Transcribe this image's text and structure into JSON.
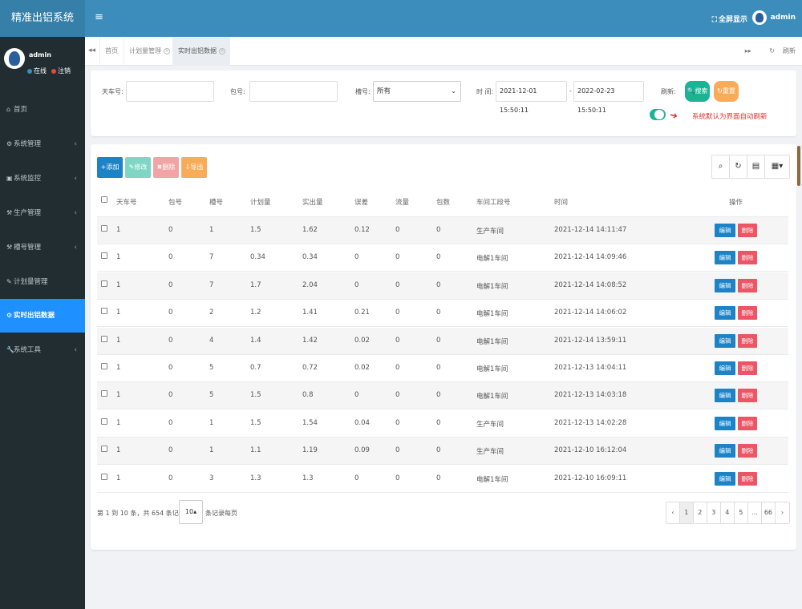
{
  "app": {
    "title": "精准出铝系统",
    "menu_icon": "≡"
  },
  "topbar": {
    "fullscreen": "全屏显示",
    "user": "admin"
  },
  "sidebar": {
    "user": {
      "name": "admin",
      "status_online": "在线",
      "logout": "注销"
    },
    "items": [
      {
        "label": "首页",
        "icon": "home-icon"
      },
      {
        "label": "系统管理",
        "icon": "gear-icon"
      },
      {
        "label": "系统监控",
        "icon": "monitor-icon"
      },
      {
        "label": "生产管理",
        "icon": "tools-icon"
      },
      {
        "label": "槽号管理",
        "icon": "tools-icon"
      },
      {
        "label": "计划量管理",
        "icon": "edit-icon"
      },
      {
        "label": "实时出铝数据",
        "icon": "gear-icon",
        "active": true
      },
      {
        "label": "系统工具",
        "icon": "wrench-icon"
      }
    ]
  },
  "tabs": {
    "items": [
      "首页",
      "计划量管理",
      "实时出铝数据"
    ],
    "refresh": "刷新"
  },
  "search": {
    "car_label": "天车号:",
    "bag_label": "包号:",
    "slot_label": "槽号:",
    "slot_value": "所有",
    "time_label": "时 间:",
    "time_start": "2021-12-01 15:50:11",
    "time_sep": "-",
    "time_end": "2022-02-23 15:50:11",
    "refresh_label": "刷新:",
    "search_btn": "搜索",
    "reset_btn": "重置",
    "hint": "系统默认为界面自动刷新"
  },
  "toolbar": {
    "add": "添加",
    "edit": "修改",
    "delete": "删除",
    "export": "导出"
  },
  "table": {
    "headers": [
      "天车号",
      "包号",
      "槽号",
      "计划量",
      "实出量",
      "误差",
      "流量",
      "包数",
      "车间工段号",
      "时间",
      "操作"
    ],
    "rows": [
      [
        "1",
        "0",
        "1",
        "1.5",
        "1.62",
        "0.12",
        "0",
        "0",
        "生产车间",
        "2021-12-14 14:11:47"
      ],
      [
        "1",
        "0",
        "7",
        "0.34",
        "0.34",
        "0",
        "0",
        "0",
        "电解1车间",
        "2021-12-14 14:09:46"
      ],
      [
        "1",
        "0",
        "7",
        "1.7",
        "2.04",
        "0",
        "0",
        "0",
        "电解1车间",
        "2021-12-14 14:08:52"
      ],
      [
        "1",
        "0",
        "2",
        "1.2",
        "1.41",
        "0.21",
        "0",
        "0",
        "电解1车间",
        "2021-12-14 14:06:02"
      ],
      [
        "1",
        "0",
        "4",
        "1.4",
        "1.42",
        "0.02",
        "0",
        "0",
        "电解1车间",
        "2021-12-14 13:59:11"
      ],
      [
        "1",
        "0",
        "5",
        "0.7",
        "0.72",
        "0.02",
        "0",
        "0",
        "电解1车间",
        "2021-12-13 14:04:11"
      ],
      [
        "1",
        "0",
        "5",
        "1.5",
        "0.8",
        "0",
        "0",
        "0",
        "电解1车间",
        "2021-12-13 14:03:18"
      ],
      [
        "1",
        "0",
        "1",
        "1.5",
        "1.54",
        "0.04",
        "0",
        "0",
        "生产车间",
        "2021-12-13 14:02:28"
      ],
      [
        "1",
        "0",
        "1",
        "1.1",
        "1.19",
        "0.09",
        "0",
        "0",
        "生产车间",
        "2021-12-10 16:12:04"
      ],
      [
        "1",
        "0",
        "3",
        "1.3",
        "1.3",
        "0",
        "0",
        "0",
        "电解1车间",
        "2021-12-10 16:09:11"
      ]
    ],
    "edit_label": "编辑",
    "delete_label": "删除"
  },
  "pagination": {
    "info": "第 1 到 10 条，共 654 条记录。",
    "page_size": "10",
    "per_page": "条记录每页",
    "pages": [
      "‹",
      "1",
      "2",
      "3",
      "4",
      "5",
      "...",
      "66",
      "›"
    ],
    "current": "1"
  },
  "colors": {
    "brand": "#3c8dbc",
    "sidebar": "#222d32",
    "active_nav": "#1e90ff",
    "search_btn": "#1ab394",
    "reset_btn": "#f8ac59",
    "primary": "#1c84c6",
    "danger": "#ed5565"
  }
}
